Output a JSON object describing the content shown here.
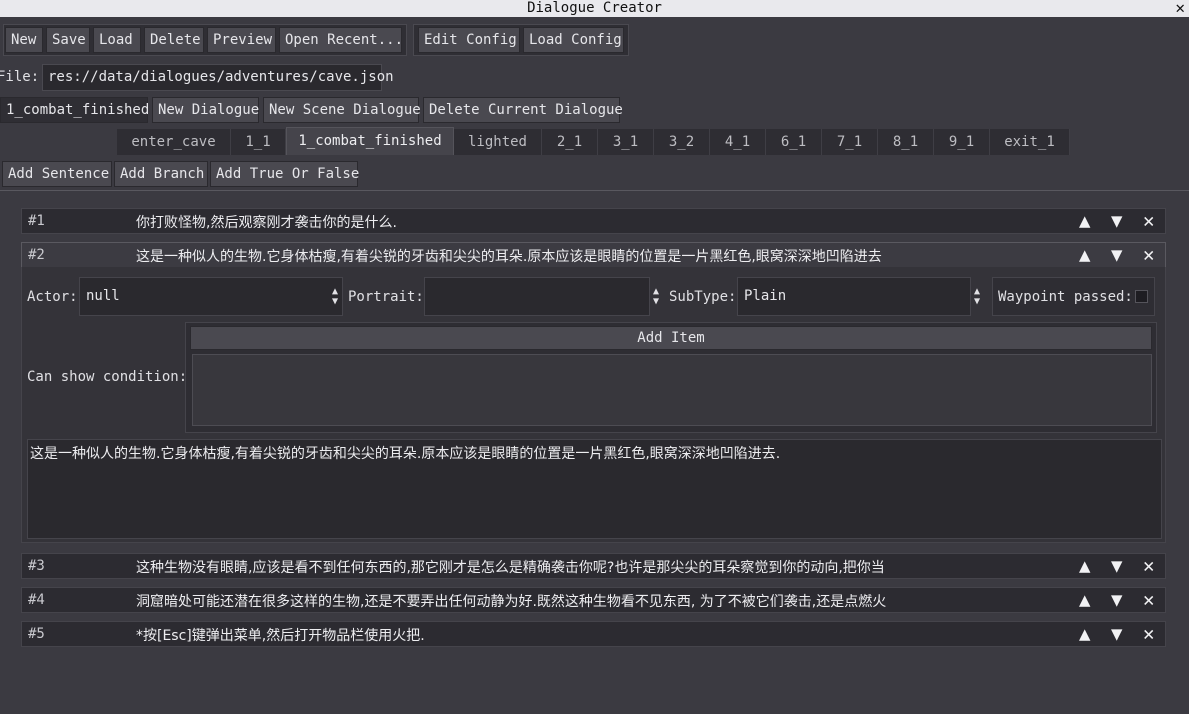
{
  "window": {
    "title": "Dialogue Creator",
    "close_glyph": "✕"
  },
  "toolbar": {
    "buttons": [
      "New",
      "Save",
      "Load",
      "Delete",
      "Preview",
      "Open Recent..."
    ],
    "config_buttons": [
      "Edit Config",
      "Load Config"
    ]
  },
  "file": {
    "label": "File:",
    "path": "res://data/dialogues/adventures/cave.json"
  },
  "dialogue_bar": {
    "current": "1_combat_finished",
    "buttons": [
      "New Dialogue",
      "New Scene Dialogue",
      "Delete Current Dialogue"
    ]
  },
  "tabs": {
    "items": [
      "enter_cave",
      "1_1",
      "1_combat_finished",
      "lighted",
      "2_1",
      "3_1",
      "3_2",
      "4_1",
      "6_1",
      "7_1",
      "8_1",
      "9_1",
      "exit_1"
    ],
    "active": "1_combat_finished"
  },
  "add_bar": {
    "buttons": [
      "Add Sentence",
      "Add Branch",
      "Add True Or False"
    ]
  },
  "sentences": [
    {
      "num": "#1",
      "text": "你打败怪物,然后观察刚才袭击你的是什么."
    },
    {
      "num": "#2",
      "text": "这是一种似人的生物.它身体枯瘦,有着尖锐的牙齿和尖尖的耳朵.原本应该是眼睛的位置是一片黑红色,眼窝深深地凹陷进去"
    },
    {
      "num": "#3",
      "text": "这种生物没有眼睛,应该是看不到任何东西的,那它刚才是怎么是精确袭击你呢?也许是那尖尖的耳朵察觉到你的动向,把你当"
    },
    {
      "num": "#4",
      "text": "洞窟暗处可能还潜在很多这样的生物,还是不要弄出任何动静为好.既然这种生物看不见东西, 为了不被它们袭击,还是点燃火"
    },
    {
      "num": "#5",
      "text": "*按[Esc]键弹出菜单,然后打开物品栏使用火把."
    }
  ],
  "row_controls": {
    "up": "▲",
    "down": "▼",
    "delete": "✕"
  },
  "editor": {
    "actor_label": "Actor:",
    "actor_value": "null",
    "portrait_label": "Portrait:",
    "portrait_value": "",
    "subtype_label": "SubType:",
    "subtype_value": "Plain",
    "waypoint_label": "Waypoint passed:",
    "waypoint_checked": false,
    "condition_label": "Can show condition:",
    "add_item_label": "Add Item",
    "full_text": "这是一种似人的生物.它身体枯瘦,有着尖锐的牙齿和尖尖的耳朵.原本应该是眼睛的位置是一片黑红色,眼窝深深地凹陷进去."
  },
  "icons": {
    "row_up": "arrow-up-icon",
    "row_down": "arrow-down-icon",
    "row_delete": "close-icon",
    "select_arrows": "updown-spinner-icon"
  },
  "colors": {
    "background": "#3b3a41",
    "titlebar": "#e9e9ed",
    "panel": "#343339",
    "field": "#2a292e"
  }
}
